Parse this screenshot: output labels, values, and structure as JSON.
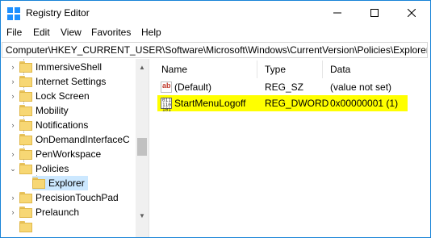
{
  "window": {
    "title": "Registry Editor",
    "controls": {
      "minimize": "–",
      "maximize": "□",
      "close": "✕"
    }
  },
  "menu": [
    "File",
    "Edit",
    "View",
    "Favorites",
    "Help"
  ],
  "address_bar": "Computer\\HKEY_CURRENT_USER\\Software\\Microsoft\\Windows\\CurrentVersion\\Policies\\Explorer",
  "tree": {
    "items": [
      {
        "label": "ImmersiveShell",
        "expand": "›"
      },
      {
        "label": "Internet Settings",
        "expand": "›"
      },
      {
        "label": "Lock Screen",
        "expand": "›"
      },
      {
        "label": "Mobility",
        "expand": ""
      },
      {
        "label": "Notifications",
        "expand": "›"
      },
      {
        "label": "OnDemandInterfaceC",
        "expand": ""
      },
      {
        "label": "PenWorkspace",
        "expand": "›"
      },
      {
        "label": "Policies",
        "expand": "⌄"
      },
      {
        "label": "Explorer",
        "expand": "",
        "selected": true
      },
      {
        "label": "PrecisionTouchPad",
        "expand": "›"
      },
      {
        "label": "Prelaunch",
        "expand": "›"
      }
    ]
  },
  "list": {
    "columns": [
      "Name",
      "Type",
      "Data"
    ],
    "rows": [
      {
        "name": "(Default)",
        "type": "REG_SZ",
        "data": "(value not set)",
        "icon": "string-value-icon"
      },
      {
        "name": "StartMenuLogoff",
        "type": "REG_DWORD",
        "data": "0x00000001 (1)",
        "icon": "binary-value-icon",
        "highlight": "#ffff00"
      }
    ]
  },
  "icons": {
    "ab": "ab",
    "binary": "011\n110\n101"
  },
  "colors": {
    "accent": "#1883d7",
    "highlight": "#ffff00",
    "selection": "#cce8ff",
    "folder": "#f7d774"
  }
}
